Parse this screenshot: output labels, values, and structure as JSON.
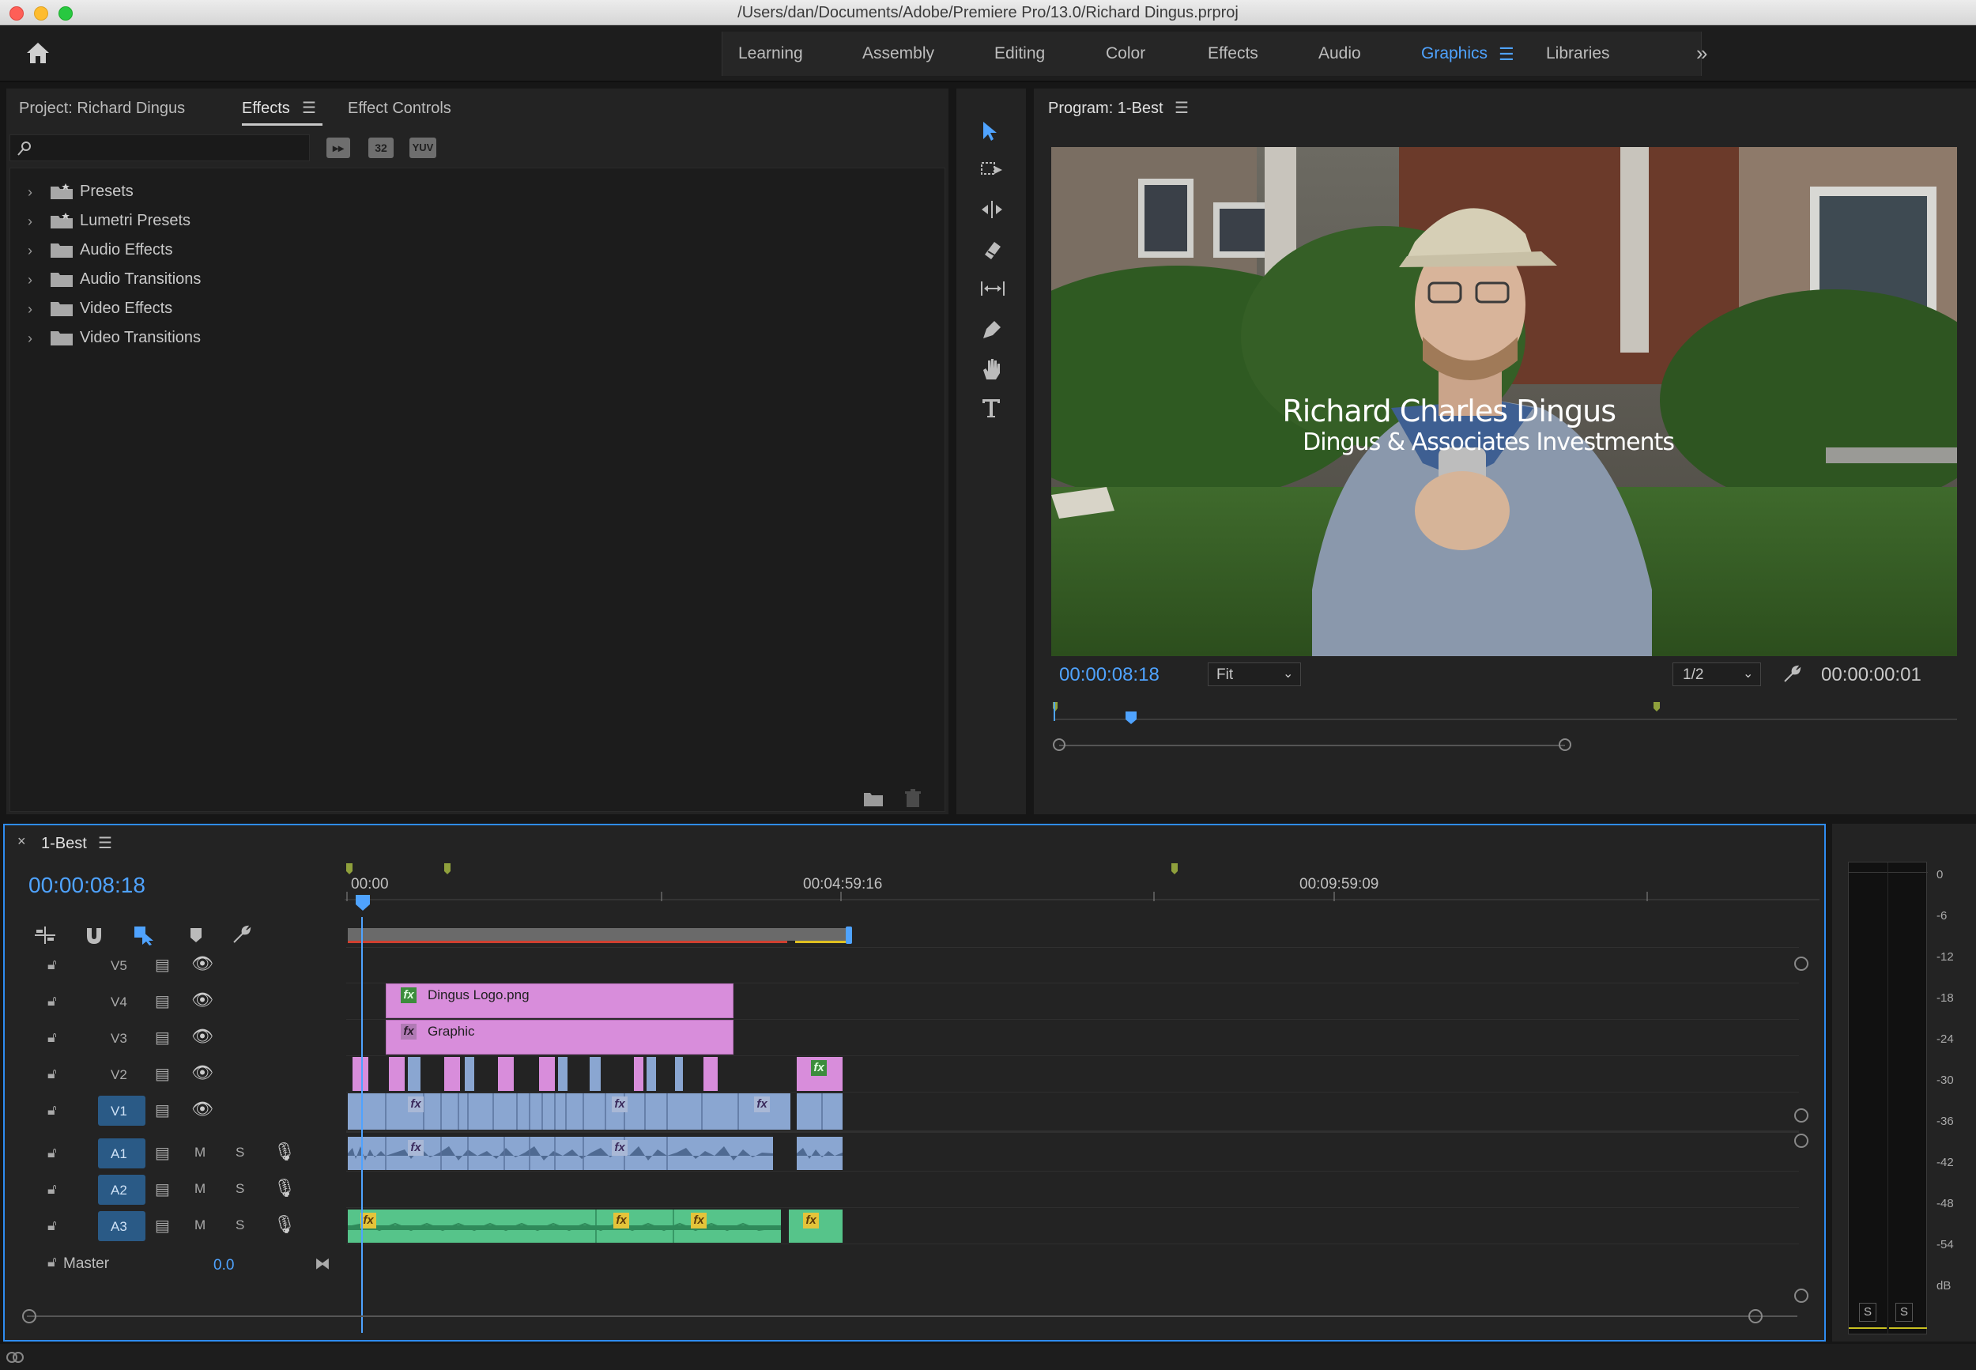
{
  "window": {
    "title": "/Users/dan/Documents/Adobe/Premiere Pro/13.0/Richard Dingus.prproj"
  },
  "workspaces": {
    "tabs": [
      "Learning",
      "Assembly",
      "Editing",
      "Color",
      "Effects",
      "Audio",
      "Graphics",
      "Libraries"
    ],
    "active": "Graphics"
  },
  "colors": {
    "accent": "#2f8cf0",
    "timecode": "#4fa3ff",
    "video_clip": "#8aa6d1",
    "graphic_clip": "#d88ddb",
    "audio_clip_a1": "#8aa6d1",
    "audio_clip_a3": "#56c48a",
    "panel_bg": "#232323"
  },
  "left_panel": {
    "tabs": [
      "Project: Richard Dingus",
      "Effects",
      "Effect Controls"
    ],
    "active_tab": "Effects",
    "search_placeholder": "",
    "filter_buttons": [
      "32",
      "YUV"
    ],
    "tree": [
      {
        "label": "Presets",
        "icon": "star-folder-icon"
      },
      {
        "label": "Lumetri Presets",
        "icon": "star-folder-icon"
      },
      {
        "label": "Audio Effects",
        "icon": "folder-icon"
      },
      {
        "label": "Audio Transitions",
        "icon": "folder-icon"
      },
      {
        "label": "Video Effects",
        "icon": "folder-icon"
      },
      {
        "label": "Video Transitions",
        "icon": "folder-icon"
      }
    ]
  },
  "tools": [
    "selection-tool-icon",
    "track-select-tool-icon",
    "ripple-edit-tool-icon",
    "razor-tool-icon",
    "slip-tool-icon",
    "pen-tool-icon",
    "hand-tool-icon",
    "type-tool-icon"
  ],
  "program_monitor": {
    "title": "Program: 1-Best",
    "lower_third_name": "Richard Charles  Dingus",
    "lower_third_sub": "Dingus & Associates Investments",
    "timecode": "00:00:08:18",
    "fit": "Fit",
    "resolution": "1/2",
    "duration": "00:00:00:01"
  },
  "timeline": {
    "sequence_name": "1-Best",
    "timecode": "00:00:08:18",
    "ruler_labels": [
      "00:00",
      "00:04:59:16",
      "00:09:59:09"
    ],
    "video_tracks": [
      "V5",
      "V4",
      "V3",
      "V2",
      "V1"
    ],
    "audio_tracks": [
      "A1",
      "A2",
      "A3"
    ],
    "track_buttons": {
      "mute": "M",
      "solo": "S"
    },
    "master_label": "Master",
    "master_value": "0.0",
    "clips": {
      "v4_label": "Dingus Logo.png",
      "v3_label": "Graphic",
      "fx": "fx"
    }
  },
  "audio_meter": {
    "labels": [
      "0",
      "-6",
      "-12",
      "-18",
      "-24",
      "-30",
      "-36",
      "-42",
      "-48",
      "-54",
      "dB"
    ],
    "solo_buttons": [
      "S",
      "S"
    ]
  }
}
